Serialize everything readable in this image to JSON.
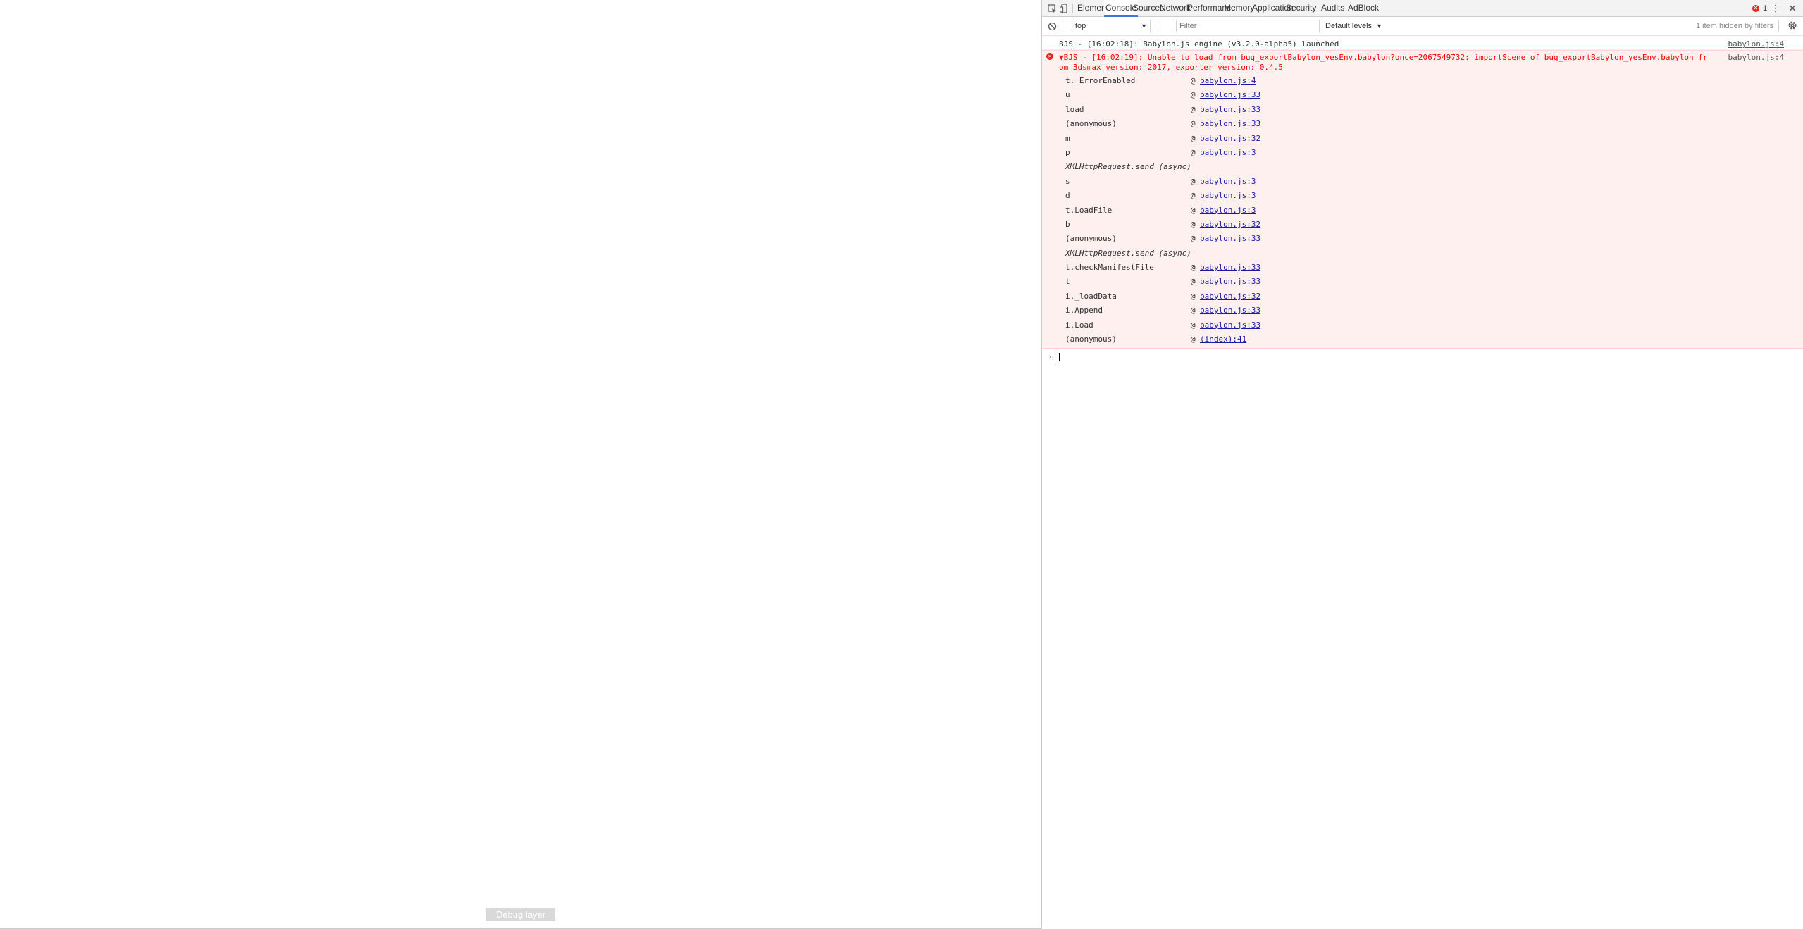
{
  "viewport": {
    "debug_button_label": "Debug layer"
  },
  "devtools": {
    "tabs": [
      {
        "label": "Elements"
      },
      {
        "label": "Console"
      },
      {
        "label": "Sources"
      },
      {
        "label": "Network"
      },
      {
        "label": "Performance"
      },
      {
        "label": "Memory"
      },
      {
        "label": "Application"
      },
      {
        "label": "Security"
      },
      {
        "label": "Audits"
      },
      {
        "label": "AdBlock"
      }
    ],
    "active_tab": "Console",
    "error_count": "1",
    "toolbar": {
      "context_value": "top",
      "filter_placeholder": "Filter",
      "levels_label": "Default levels",
      "hidden_text": "1 item hidden by filters"
    },
    "console": {
      "info_line": {
        "text": "BJS - [16:02:18]: Babylon.js engine (v3.2.0-alpha5) launched",
        "source": "babylon.js:4"
      },
      "error": {
        "message": "▼BJS - [16:02:19]: Unable to load from bug_exportBabylon_yesEnv.babylon?once=2067549732: importScene of bug_exportBabylon_yesEnv.babylon from 3dsmax version: 2017, exporter version: 0.4.5",
        "source": "babylon.js:4",
        "trace": [
          {
            "fn": "t._ErrorEnabled",
            "at": "@",
            "link": "babylon.js:4"
          },
          {
            "fn": "u",
            "at": "@",
            "link": "babylon.js:33"
          },
          {
            "fn": "load",
            "at": "@",
            "link": "babylon.js:33"
          },
          {
            "fn": "(anonymous)",
            "at": "@",
            "link": "babylon.js:33"
          },
          {
            "fn": "m",
            "at": "@",
            "link": "babylon.js:32"
          },
          {
            "fn": "p",
            "at": "@",
            "link": "babylon.js:3"
          },
          {
            "async": "XMLHttpRequest.send (async)"
          },
          {
            "fn": "s",
            "at": "@",
            "link": "babylon.js:3"
          },
          {
            "fn": "d",
            "at": "@",
            "link": "babylon.js:3"
          },
          {
            "fn": "t.LoadFile",
            "at": "@",
            "link": "babylon.js:3"
          },
          {
            "fn": "b",
            "at": "@",
            "link": "babylon.js:32"
          },
          {
            "fn": "(anonymous)",
            "at": "@",
            "link": "babylon.js:33"
          },
          {
            "async": "XMLHttpRequest.send (async)"
          },
          {
            "fn": "t.checkManifestFile",
            "at": "@",
            "link": "babylon.js:33"
          },
          {
            "fn": "t",
            "at": "@",
            "link": "babylon.js:33"
          },
          {
            "fn": "i._loadData",
            "at": "@",
            "link": "babylon.js:32"
          },
          {
            "fn": "i.Append",
            "at": "@",
            "link": "babylon.js:33"
          },
          {
            "fn": "i.Load",
            "at": "@",
            "link": "babylon.js:33"
          },
          {
            "fn": "(anonymous)",
            "at": "@",
            "link": "(index):41"
          }
        ]
      },
      "prompt_symbol": "›"
    },
    "icons": {
      "inspect": "inspect-element-icon",
      "device": "device-toolbar-icon",
      "clear": "clear-console-icon",
      "more": "more-vertical-icon",
      "close": "close-icon",
      "settings": "gear-icon",
      "error": "error-circle-icon"
    }
  }
}
